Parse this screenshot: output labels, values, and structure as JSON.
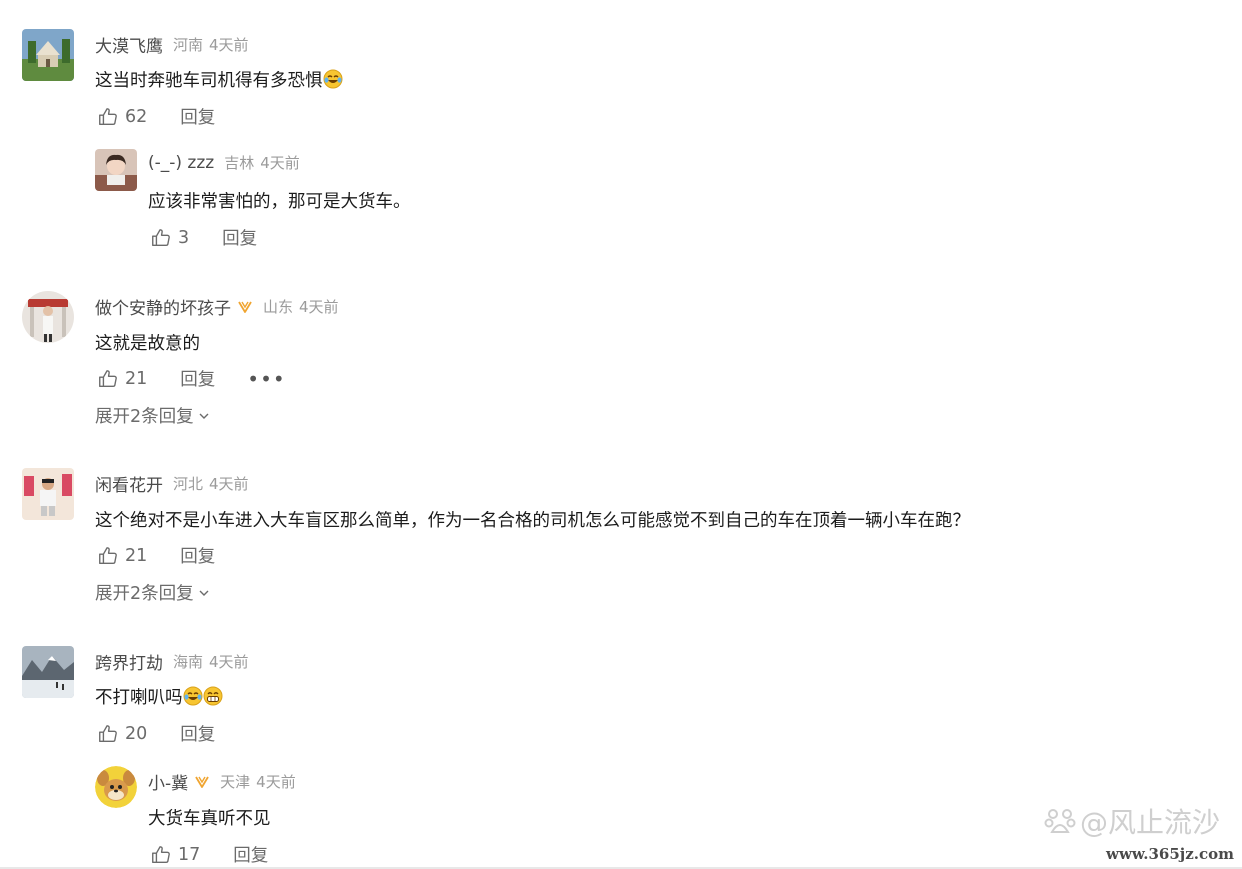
{
  "comments": [
    {
      "user": "大漠飞鹰",
      "location": "河南",
      "time": "4天前",
      "text": "这当时奔驰车司机得有多恐惧",
      "likes": "62",
      "reply_label": "回复",
      "replies": [
        {
          "user": "(-_-) zzz",
          "location": "吉林",
          "time": "4天前",
          "text": "应该非常害怕的，那可是大货车。",
          "likes": "3",
          "reply_label": "回复"
        }
      ]
    },
    {
      "user": "做个安静的坏孩子",
      "location": "山东",
      "time": "4天前",
      "text": "这就是故意的",
      "likes": "21",
      "reply_label": "回复",
      "more": "•••",
      "expand": "展开2条回复"
    },
    {
      "user": "闲看花开",
      "location": "河北",
      "time": "4天前",
      "text": "这个绝对不是小车进入大车盲区那么简单，作为一名合格的司机怎么可能感觉不到自己的车在顶着一辆小车在跑？",
      "likes": "21",
      "reply_label": "回复",
      "expand": "展开2条回复"
    },
    {
      "user": "跨界打劫",
      "location": "海南",
      "time": "4天前",
      "text": "不打喇叭吗",
      "likes": "20",
      "reply_label": "回复",
      "replies": [
        {
          "user": "小-冀",
          "location": "天津",
          "time": "4天前",
          "text": "大货车真听不见",
          "likes": "17",
          "reply_label": "回复"
        }
      ]
    }
  ],
  "watermark": "@风止流沙",
  "site": "www.365jz.com",
  "colors": {
    "vip_badge": "#f0a531",
    "meta": "#9b9b9b",
    "action": "#6b6b6b"
  },
  "icons": {
    "like": "thumb-up-icon",
    "vip": "vip-badge-icon",
    "expand": "chevron-down-icon"
  }
}
